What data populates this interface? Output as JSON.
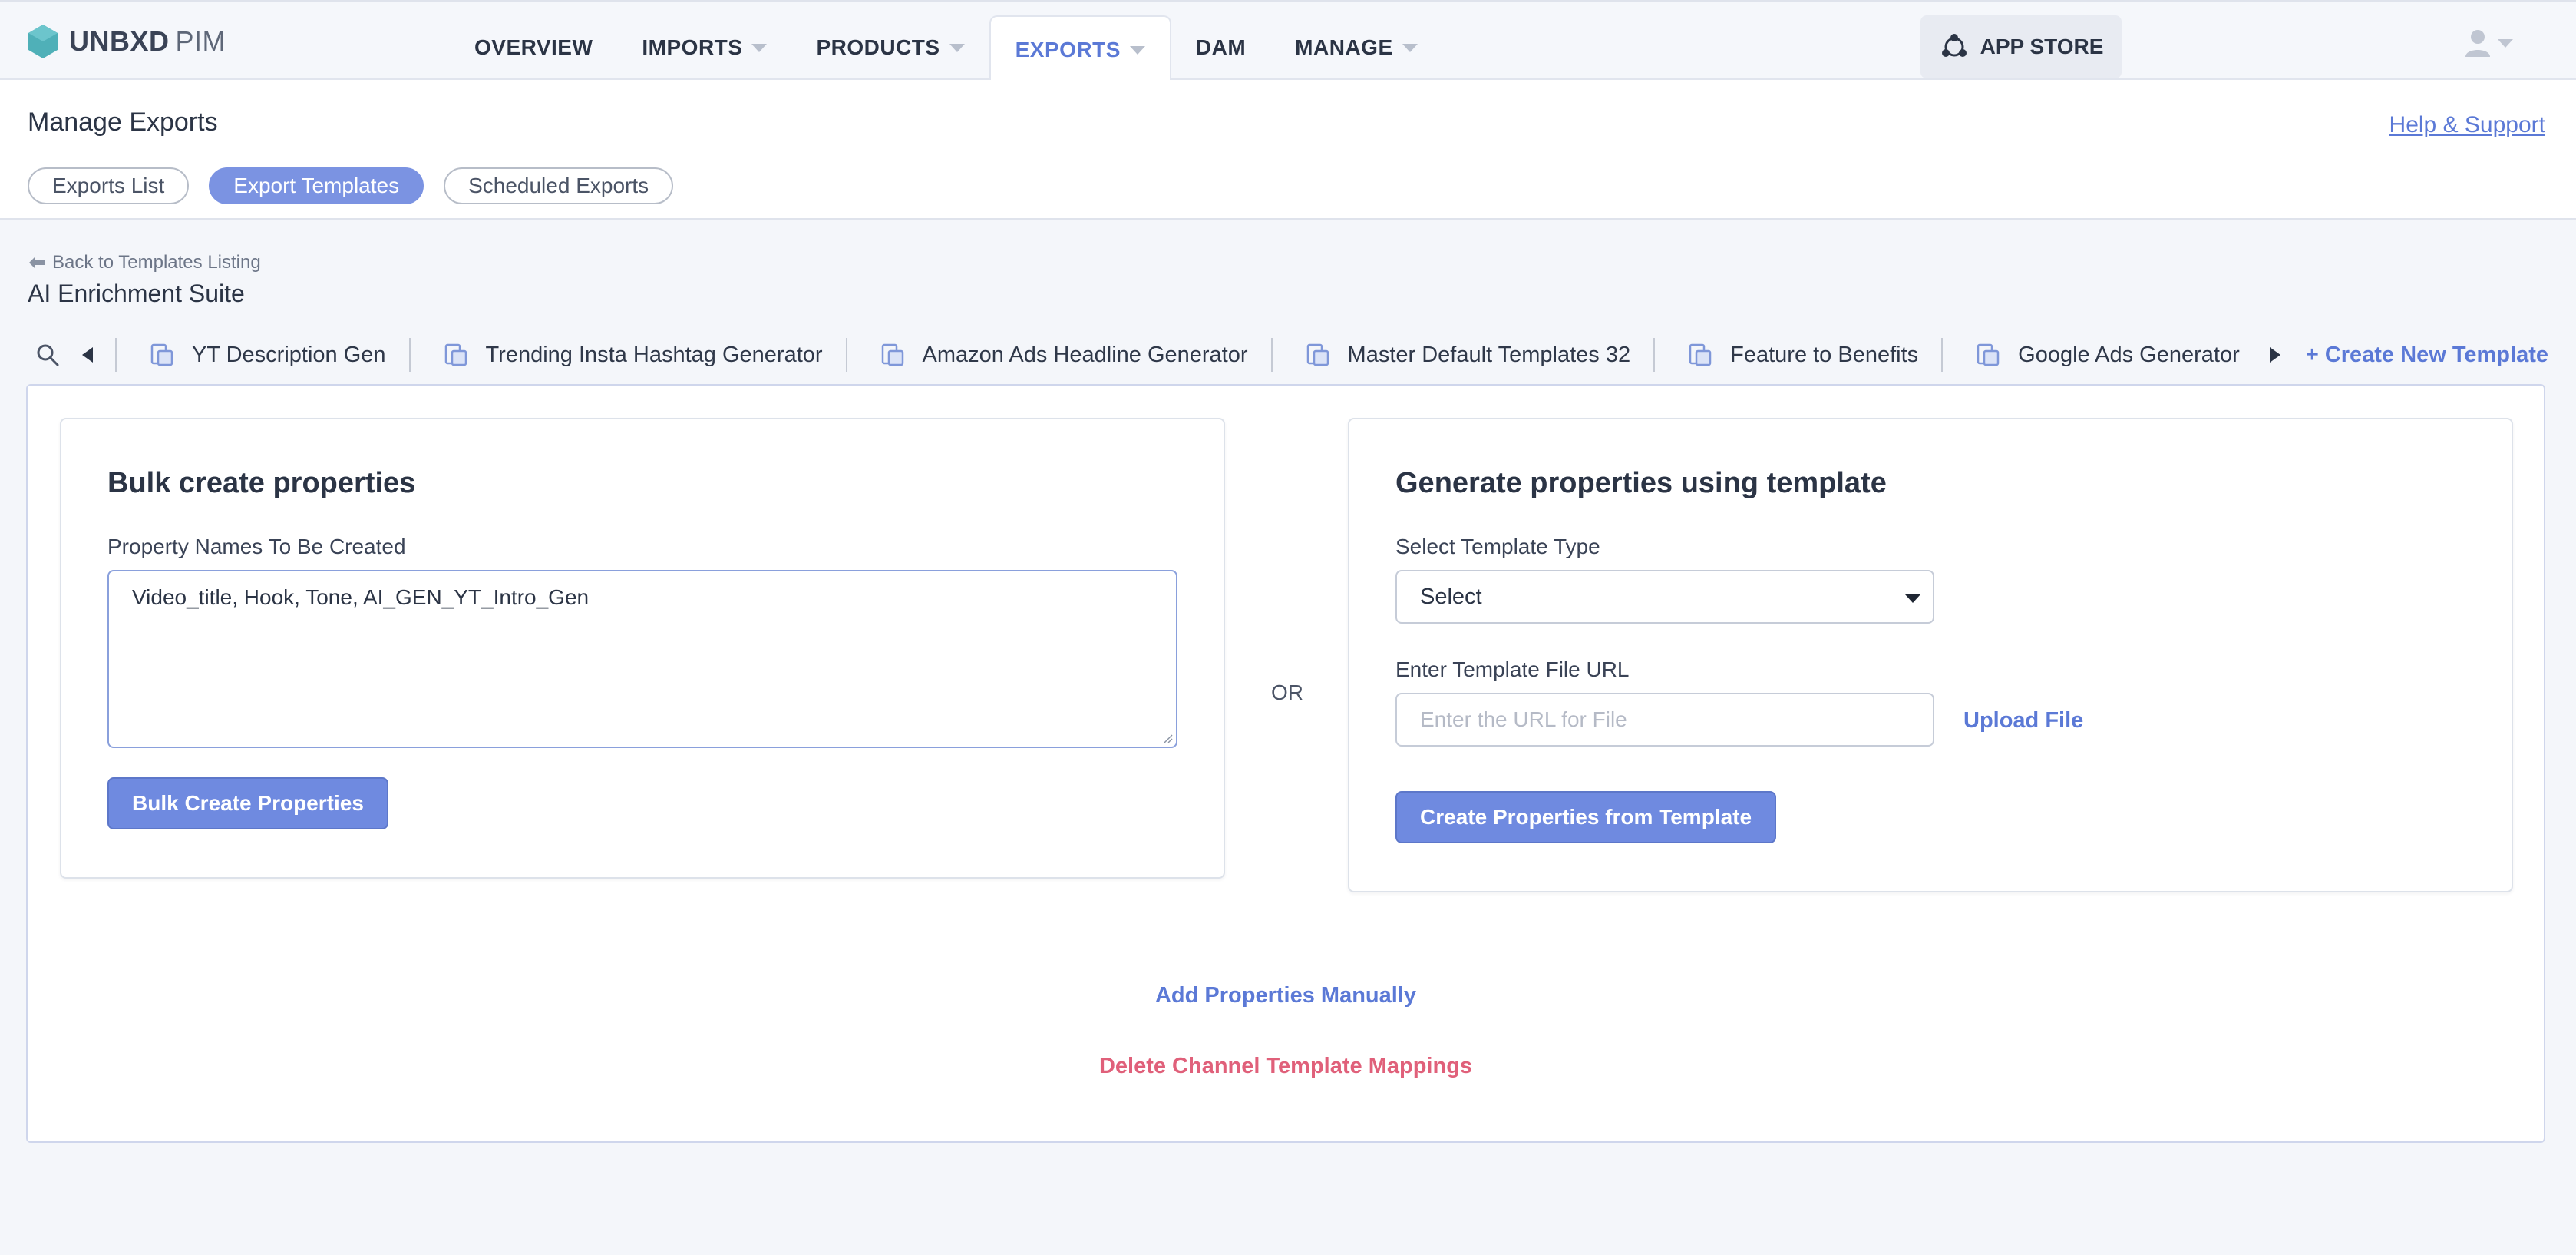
{
  "app": {
    "logo_brand": "UNBXD",
    "logo_product": "PIM"
  },
  "nav": [
    {
      "label": "OVERVIEW",
      "has_caret": false,
      "active": false
    },
    {
      "label": "IMPORTS",
      "has_caret": true,
      "active": false
    },
    {
      "label": "PRODUCTS",
      "has_caret": true,
      "active": false
    },
    {
      "label": "EXPORTS",
      "has_caret": true,
      "active": true
    },
    {
      "label": "DAM",
      "has_caret": false,
      "active": false
    },
    {
      "label": "MANAGE",
      "has_caret": true,
      "active": false
    }
  ],
  "app_store": {
    "label": "APP STORE",
    "icon": "app-store-icon"
  },
  "user_menu": {
    "icon": "user-icon"
  },
  "page": {
    "title": "Manage Exports",
    "help_link": "Help & Support"
  },
  "pills": [
    {
      "label": "Exports List",
      "active": false
    },
    {
      "label": "Export Templates",
      "active": true
    },
    {
      "label": "Scheduled Exports",
      "active": false
    }
  ],
  "back_link": "Back to Templates Listing",
  "suite_title": "AI Enrichment Suite",
  "template_tabs": [
    {
      "label": "YT Description Gen",
      "icon": "template-icon"
    },
    {
      "label": "Trending Insta Hashtag Generator",
      "icon": "template-icon"
    },
    {
      "label": "Amazon Ads Headline Generator",
      "icon": "template-icon"
    },
    {
      "label": "Master Default Templates 32",
      "icon": "template-icon"
    },
    {
      "label": "Feature to Benefits",
      "icon": "template-icon"
    },
    {
      "label": "Google Ads Generator",
      "icon": "template-icon"
    }
  ],
  "create_new_template": "+ Create New Template",
  "bulk_card": {
    "title": "Bulk create properties",
    "field_label": "Property Names To Be Created",
    "textarea_value": "Video_title, Hook, Tone, AI_GEN_YT_Intro_Gen",
    "button_label": "Bulk Create Properties"
  },
  "or_label": "OR",
  "template_card": {
    "title": "Generate properties using template",
    "type_label": "Select Template Type",
    "type_selected": "Select",
    "url_label": "Enter Template File URL",
    "url_placeholder": "Enter the URL for File",
    "upload_label": "Upload File",
    "button_label": "Create Properties from Template"
  },
  "add_manually": "Add Properties Manually",
  "delete_mappings": "Delete Channel Template Mappings",
  "colors": {
    "accent": "#5b79d6",
    "button": "#6f8ae0",
    "danger": "#e0607a",
    "logo": "#4fb0b8"
  }
}
